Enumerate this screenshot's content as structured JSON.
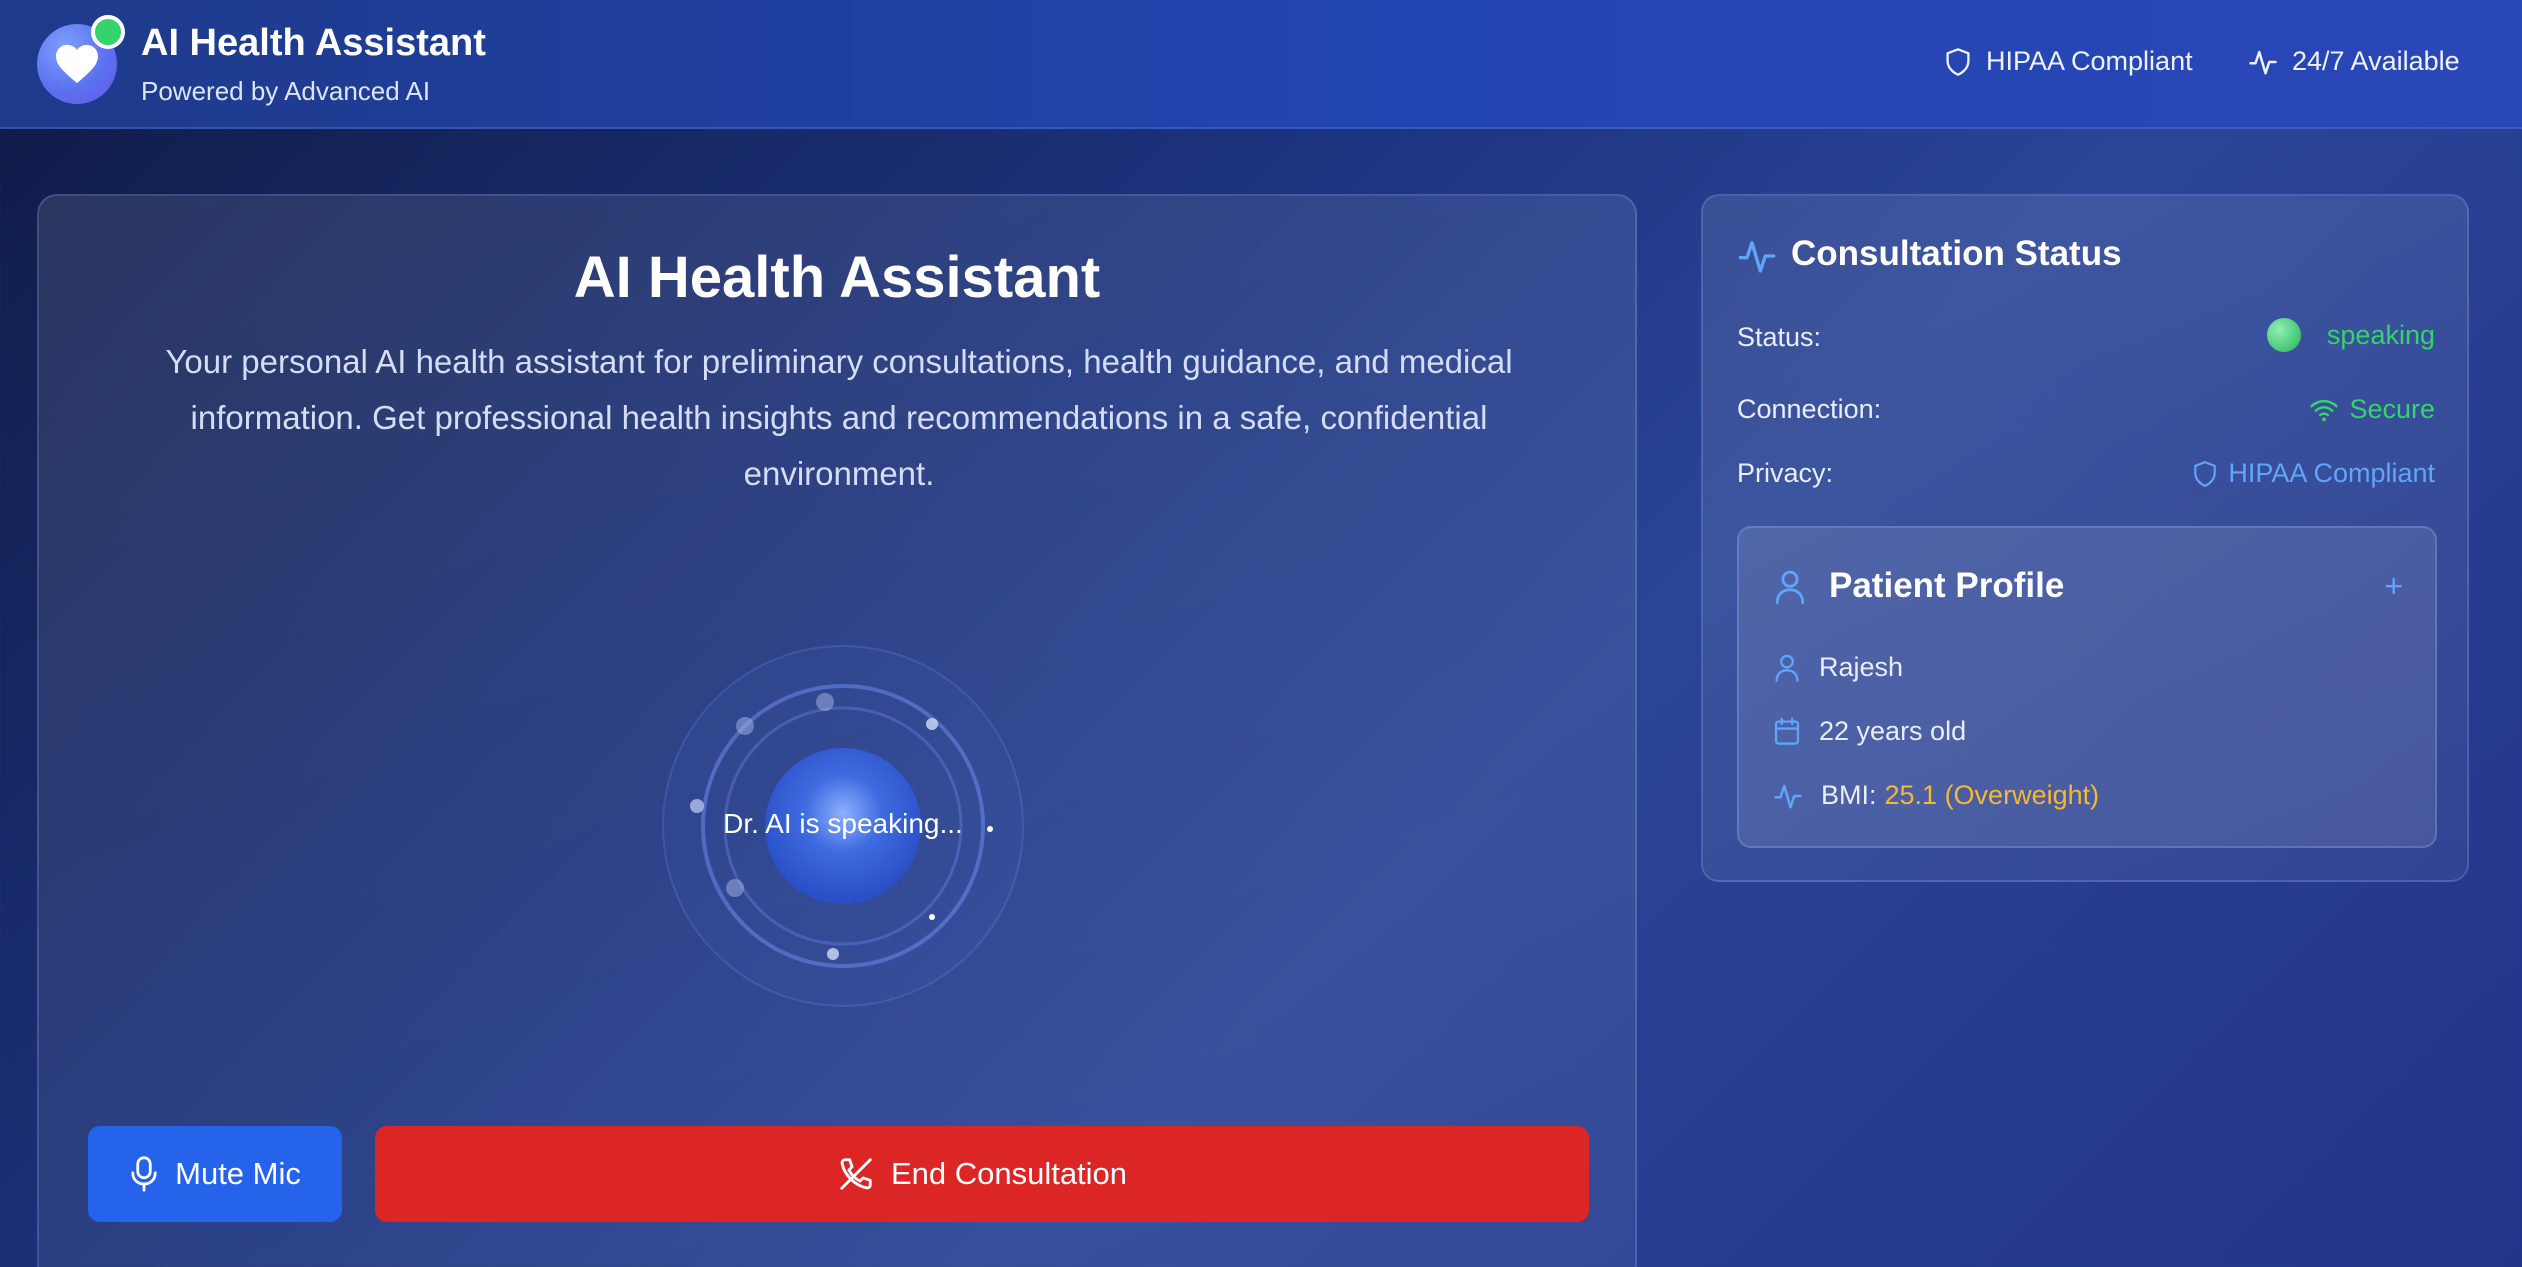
{
  "header": {
    "title": "AI Health Assistant",
    "subtitle": "Powered by Advanced AI",
    "badges": [
      {
        "icon": "shield-icon",
        "label": "HIPAA Compliant"
      },
      {
        "icon": "activity-icon",
        "label": "24/7 Available"
      }
    ]
  },
  "main": {
    "title": "AI Health Assistant",
    "description": "Your personal AI health assistant for preliminary consultations, health guidance, and medical information. Get professional health insights and recommendations in a safe, confidential environment.",
    "orb_label": "Dr. AI is speaking...",
    "mute_label": "Mute Mic",
    "end_label": "End Consultation"
  },
  "status_panel": {
    "title": "Consultation Status",
    "status_label": "Status:",
    "status_value": "speaking",
    "connection_label": "Connection:",
    "connection_value": "Secure",
    "privacy_label": "Privacy:",
    "privacy_value": "HIPAA Compliant"
  },
  "profile": {
    "title": "Patient Profile",
    "add_label": "+",
    "name": "Rajesh",
    "age": "22 years old",
    "bmi_label": "BMI:",
    "bmi_value": "25.1 (Overweight)"
  },
  "colors": {
    "accent_blue": "#2563eb",
    "danger_red": "#dc2626",
    "success_green": "#34d36b",
    "link_blue": "#60a5fa",
    "warning_amber": "#f5b82e"
  }
}
